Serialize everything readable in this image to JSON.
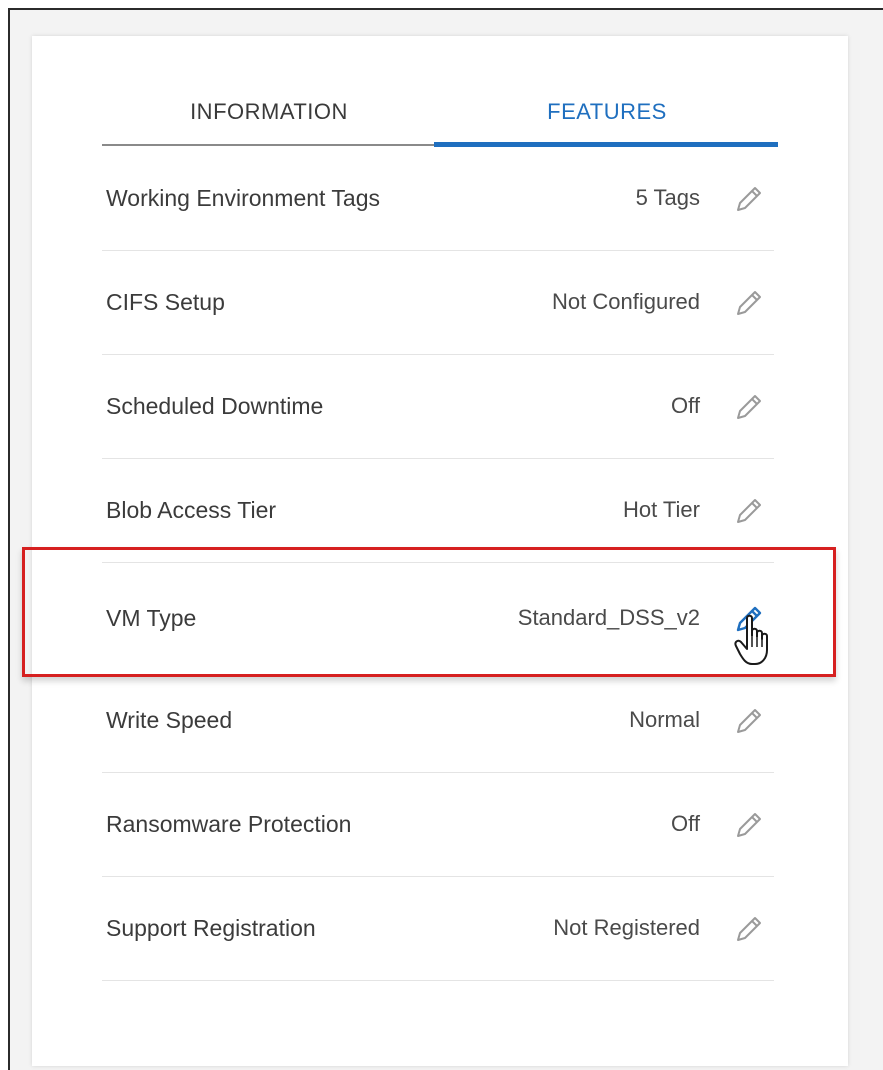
{
  "tabs": [
    {
      "label": "INFORMATION",
      "active": false
    },
    {
      "label": "FEATURES",
      "active": true
    }
  ],
  "rows": [
    {
      "label": "Working Environment Tags",
      "value": "5 Tags"
    },
    {
      "label": "CIFS Setup",
      "value": "Not Configured"
    },
    {
      "label": "Scheduled Downtime",
      "value": "Off"
    },
    {
      "label": "Blob Access Tier",
      "value": "Hot Tier"
    },
    {
      "label": "VM Type",
      "value": "Standard_DSS_v2",
      "highlighted": true
    },
    {
      "label": "Write Speed",
      "value": "Normal"
    },
    {
      "label": "Ransomware Protection",
      "value": "Off"
    },
    {
      "label": "Support Registration",
      "value": "Not Registered"
    }
  ],
  "icons": {
    "edit": "pencil-icon",
    "cursor": "hand-pointer-icon"
  },
  "colors": {
    "accent": "#1f6fbf",
    "highlight": "#d62020",
    "text": "#3b3b3b"
  }
}
